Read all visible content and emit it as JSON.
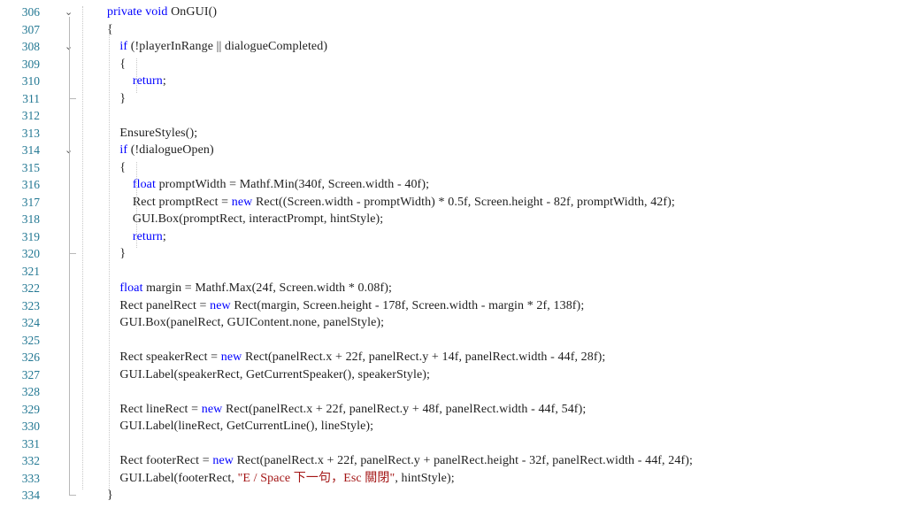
{
  "editor": {
    "lines": [
      {
        "num": "306",
        "fold": "⌄",
        "indent": "",
        "tokens": [
          {
            "t": "private",
            "c": "kw"
          },
          {
            "t": " "
          },
          {
            "t": "void",
            "c": "kw"
          },
          {
            "t": " OnGUI()"
          }
        ]
      },
      {
        "num": "307",
        "fold": "",
        "indent": "",
        "tokens": [
          {
            "t": "{"
          }
        ]
      },
      {
        "num": "308",
        "fold": "⌄",
        "indent": "    ",
        "tokens": [
          {
            "t": "if",
            "c": "kw"
          },
          {
            "t": " (!playerInRange || dialogueCompleted)"
          }
        ]
      },
      {
        "num": "309",
        "fold": "",
        "indent": "    ",
        "tokens": [
          {
            "t": "{"
          }
        ]
      },
      {
        "num": "310",
        "fold": "",
        "indent": "        ",
        "tokens": [
          {
            "t": "return",
            "c": "kw"
          },
          {
            "t": ";"
          }
        ]
      },
      {
        "num": "311",
        "fold": "",
        "indent": "    ",
        "tokens": [
          {
            "t": "}"
          }
        ]
      },
      {
        "num": "312",
        "fold": "",
        "indent": "",
        "tokens": []
      },
      {
        "num": "313",
        "fold": "",
        "indent": "    ",
        "tokens": [
          {
            "t": "EnsureStyles();"
          }
        ]
      },
      {
        "num": "314",
        "fold": "⌄",
        "indent": "    ",
        "tokens": [
          {
            "t": "if",
            "c": "kw"
          },
          {
            "t": " (!dialogueOpen)"
          }
        ]
      },
      {
        "num": "315",
        "fold": "",
        "indent": "    ",
        "tokens": [
          {
            "t": "{"
          }
        ]
      },
      {
        "num": "316",
        "fold": "",
        "indent": "        ",
        "tokens": [
          {
            "t": "float",
            "c": "kw"
          },
          {
            "t": " promptWidth = Mathf.Min(340f, Screen.width - 40f);"
          }
        ]
      },
      {
        "num": "317",
        "fold": "",
        "indent": "        ",
        "tokens": [
          {
            "t": "Rect promptRect = "
          },
          {
            "t": "new",
            "c": "kw"
          },
          {
            "t": " Rect((Screen.width - promptWidth) * 0.5f, Screen.height - 82f, promptWidth, 42f);"
          }
        ]
      },
      {
        "num": "318",
        "fold": "",
        "indent": "        ",
        "tokens": [
          {
            "t": "GUI.Box(promptRect, interactPrompt, hintStyle);"
          }
        ]
      },
      {
        "num": "319",
        "fold": "",
        "indent": "        ",
        "tokens": [
          {
            "t": "return",
            "c": "kw"
          },
          {
            "t": ";"
          }
        ]
      },
      {
        "num": "320",
        "fold": "",
        "indent": "    ",
        "tokens": [
          {
            "t": "}"
          }
        ]
      },
      {
        "num": "321",
        "fold": "",
        "indent": "",
        "tokens": []
      },
      {
        "num": "322",
        "fold": "",
        "indent": "    ",
        "tokens": [
          {
            "t": "float",
            "c": "kw"
          },
          {
            "t": " margin = Mathf.Max(24f, Screen.width * 0.08f);"
          }
        ]
      },
      {
        "num": "323",
        "fold": "",
        "indent": "    ",
        "tokens": [
          {
            "t": "Rect panelRect = "
          },
          {
            "t": "new",
            "c": "kw"
          },
          {
            "t": " Rect(margin, Screen.height - 178f, Screen.width - margin * 2f, 138f);"
          }
        ]
      },
      {
        "num": "324",
        "fold": "",
        "indent": "    ",
        "tokens": [
          {
            "t": "GUI.Box(panelRect, GUIContent.none, panelStyle);"
          }
        ]
      },
      {
        "num": "325",
        "fold": "",
        "indent": "",
        "tokens": []
      },
      {
        "num": "326",
        "fold": "",
        "indent": "    ",
        "tokens": [
          {
            "t": "Rect speakerRect = "
          },
          {
            "t": "new",
            "c": "kw"
          },
          {
            "t": " Rect(panelRect.x + 22f, panelRect.y + 14f, panelRect.width - 44f, 28f);"
          }
        ]
      },
      {
        "num": "327",
        "fold": "",
        "indent": "    ",
        "tokens": [
          {
            "t": "GUI.Label(speakerRect, GetCurrentSpeaker(), speakerStyle);"
          }
        ]
      },
      {
        "num": "328",
        "fold": "",
        "indent": "",
        "tokens": []
      },
      {
        "num": "329",
        "fold": "",
        "indent": "    ",
        "tokens": [
          {
            "t": "Rect lineRect = "
          },
          {
            "t": "new",
            "c": "kw"
          },
          {
            "t": " Rect(panelRect.x + 22f, panelRect.y + 48f, panelRect.width - 44f, 54f);"
          }
        ]
      },
      {
        "num": "330",
        "fold": "",
        "indent": "    ",
        "tokens": [
          {
            "t": "GUI.Label(lineRect, GetCurrentLine(), lineStyle);"
          }
        ]
      },
      {
        "num": "331",
        "fold": "",
        "indent": "",
        "tokens": []
      },
      {
        "num": "332",
        "fold": "",
        "indent": "    ",
        "tokens": [
          {
            "t": "Rect footerRect = "
          },
          {
            "t": "new",
            "c": "kw"
          },
          {
            "t": " Rect(panelRect.x + 22f, panelRect.y + panelRect.height - 32f, panelRect.width - 44f, 24f);"
          }
        ]
      },
      {
        "num": "333",
        "fold": "",
        "indent": "    ",
        "tokens": [
          {
            "t": "GUI.Label(footerRect, "
          },
          {
            "t": "\"E / Space 下一句，Esc 關閉\"",
            "c": "str"
          },
          {
            "t": ", hintStyle);"
          }
        ]
      },
      {
        "num": "334",
        "fold": "",
        "indent": "",
        "tokens": [
          {
            "t": "}"
          }
        ]
      }
    ]
  },
  "colors": {
    "background": "#ffffff",
    "line_number": "#237893",
    "keyword": "#0000ff",
    "string": "#a31515",
    "text": "#1e1e1e"
  },
  "icons": {
    "fold": "chevron-down-icon"
  }
}
